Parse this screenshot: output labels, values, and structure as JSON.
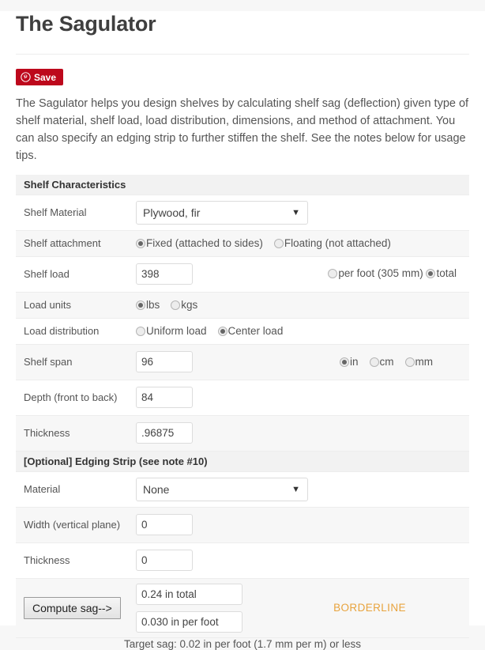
{
  "page": {
    "title": "The Sagulator",
    "intro": "The Sagulator helps you design shelves by calculating shelf sag (deflection) given type of shelf material, shelf load, load distribution, dimensions, and method of attachment. You can also specify an edging strip to further stiffen the shelf. See the notes below for usage tips.",
    "accent_red": "#bd081c",
    "verdict_color": "#e8a33d"
  },
  "save_button": {
    "label": "Save",
    "icon": "pinterest-icon"
  },
  "shelf_section": {
    "heading": "Shelf Characteristics",
    "material": {
      "label": "Shelf Material",
      "value": "Plywood, fir",
      "options": [
        "Plywood, fir"
      ]
    },
    "attachment": {
      "label": "Shelf attachment",
      "options": [
        {
          "label": "Fixed (attached to sides)",
          "checked": true
        },
        {
          "label": "Floating (not attached)",
          "checked": false
        }
      ]
    },
    "load": {
      "label": "Shelf load",
      "value": "398",
      "options": [
        {
          "label": "per foot (305 mm)",
          "checked": false
        },
        {
          "label": "total",
          "checked": true
        }
      ]
    },
    "load_units": {
      "label": "Load units",
      "options": [
        {
          "label": "lbs",
          "checked": true
        },
        {
          "label": "kgs",
          "checked": false
        }
      ]
    },
    "load_distribution": {
      "label": "Load distribution",
      "options": [
        {
          "label": "Uniform load",
          "checked": false
        },
        {
          "label": "Center load",
          "checked": true
        }
      ]
    },
    "span": {
      "label": "Shelf span",
      "value": "96",
      "units": [
        {
          "label": "in",
          "checked": true
        },
        {
          "label": "cm",
          "checked": false
        },
        {
          "label": "mm",
          "checked": false
        }
      ]
    },
    "depth": {
      "label": "Depth (front to back)",
      "value": "84"
    },
    "thickness": {
      "label": "Thickness",
      "value": ".96875"
    }
  },
  "edging_section": {
    "heading": "[Optional]  Edging Strip (see note #10)",
    "material": {
      "label": "Material",
      "value": "None",
      "options": [
        "None"
      ]
    },
    "width": {
      "label": "Width (vertical plane)",
      "value": "0"
    },
    "thickness": {
      "label": "Thickness",
      "value": "0"
    }
  },
  "compute": {
    "button_label": "Compute sag-->",
    "result_total": "0.24 in total",
    "result_per_foot": "0.030 in per foot",
    "verdict": "BORDERLINE",
    "target_sag": "Target sag: 0.02 in per foot (1.7 mm per m) or less"
  }
}
